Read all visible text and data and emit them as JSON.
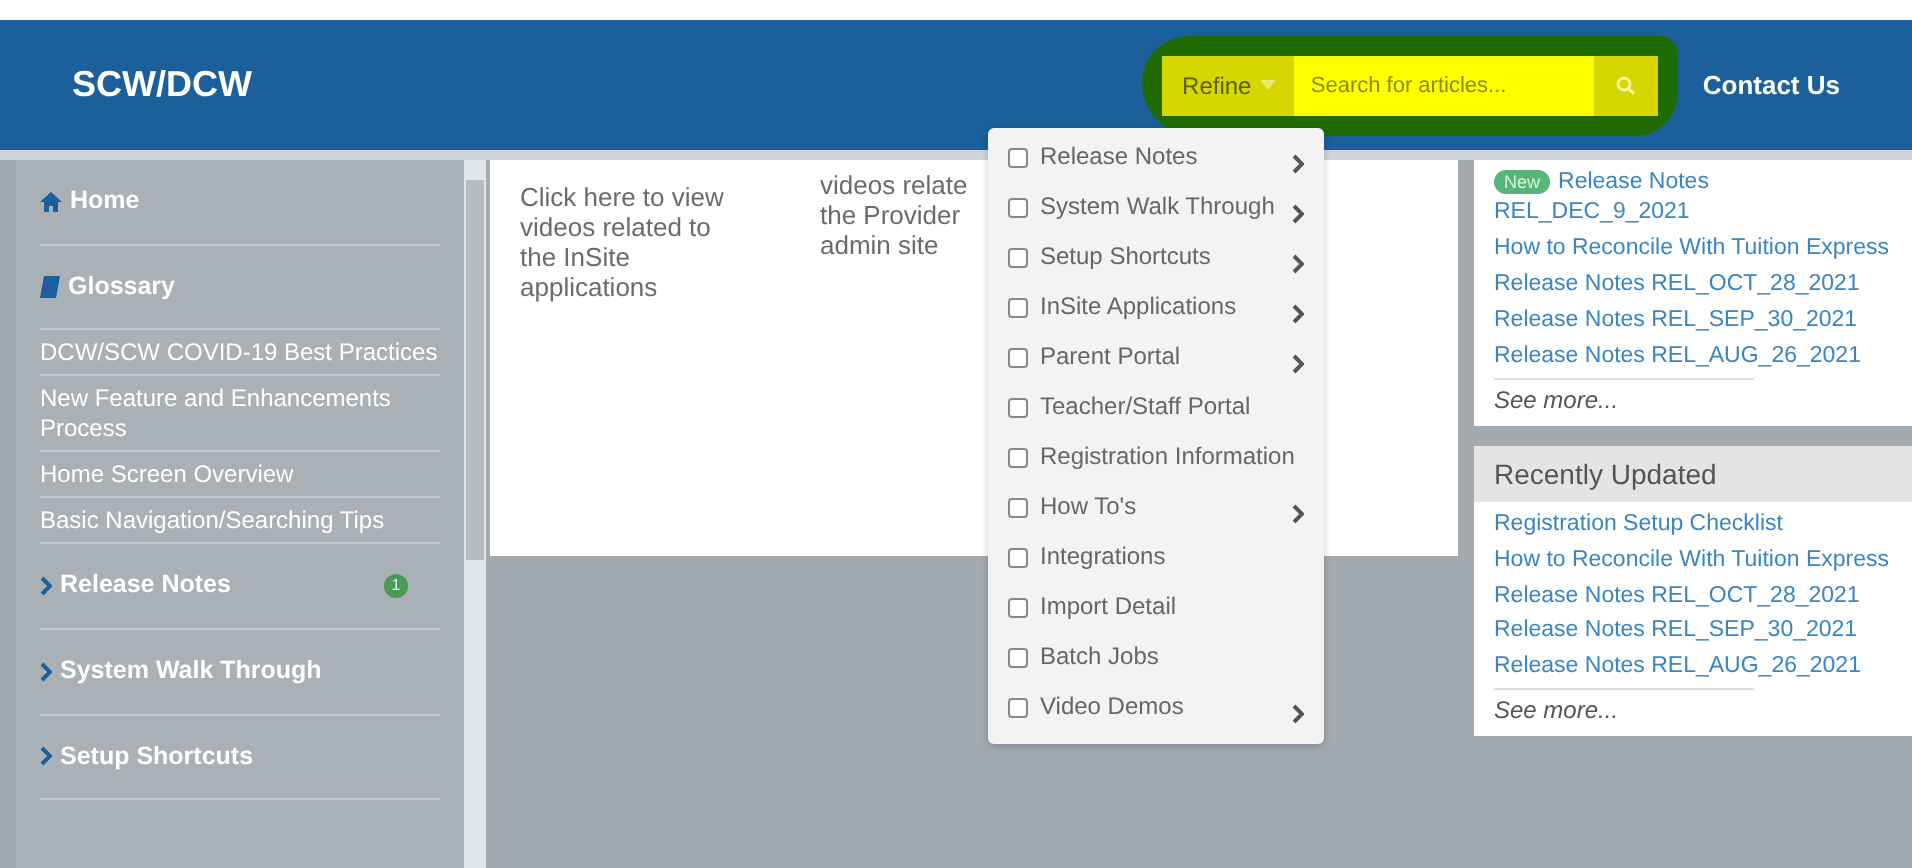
{
  "header": {
    "title": "SCW/DCW",
    "refine": "Refine",
    "search": {
      "placeholder": "Search for articles..."
    },
    "contact": "Contact Us"
  },
  "sidebar": {
    "items": [
      {
        "kind": "home",
        "label": "Home"
      },
      {
        "kind": "book",
        "label": "Glossary"
      },
      {
        "kind": "link",
        "label": "DCW/SCW COVID-19 Best Practices"
      },
      {
        "kind": "link",
        "label": "New Feature and Enhancements Process"
      },
      {
        "kind": "link",
        "label": "Home Screen Overview"
      },
      {
        "kind": "link",
        "label": "Basic Navigation/Searching Tips"
      },
      {
        "kind": "section",
        "label": "Release Notes",
        "badge": "1"
      },
      {
        "kind": "section",
        "label": "System Walk Through"
      },
      {
        "kind": "section",
        "label": "Setup Shortcuts"
      }
    ]
  },
  "tiles": [
    {
      "lines": [
        "Click here to view",
        "videos related to",
        "the InSite",
        "applications"
      ]
    },
    {
      "lines": [
        "videos relate",
        "the Provider",
        "admin site"
      ]
    }
  ],
  "refine_menu": {
    "items": [
      {
        "label": "Release Notes",
        "checked": false,
        "submenu": true
      },
      {
        "label": "System Walk Through",
        "checked": false,
        "submenu": true
      },
      {
        "label": "Setup Shortcuts",
        "checked": false,
        "submenu": true
      },
      {
        "label": "InSite Applications",
        "checked": false,
        "submenu": true
      },
      {
        "label": "Parent Portal",
        "checked": false,
        "submenu": true
      },
      {
        "label": "Teacher/Staff Portal",
        "checked": false,
        "submenu": false
      },
      {
        "label": "Registration Information",
        "checked": false,
        "submenu": false
      },
      {
        "label": "How To's",
        "checked": false,
        "submenu": true
      },
      {
        "label": "Integrations",
        "checked": false,
        "submenu": false
      },
      {
        "label": "Import Detail",
        "checked": false,
        "submenu": false
      },
      {
        "label": "Batch Jobs",
        "checked": false,
        "submenu": false
      },
      {
        "label": "Video Demos",
        "checked": false,
        "submenu": true
      }
    ]
  },
  "latest": {
    "items": [
      {
        "badge": "New",
        "label": "Release Notes REL_DEC_9_2021"
      },
      {
        "label": "How to Reconcile With Tuition Express"
      },
      {
        "label": "Release Notes REL_OCT_28_2021"
      },
      {
        "label": "Release Notes REL_SEP_30_2021"
      },
      {
        "label": "Release Notes REL_AUG_26_2021"
      }
    ],
    "see_more": "See more..."
  },
  "recently_updated": {
    "title": "Recently Updated",
    "items": [
      {
        "label": "Registration Setup Checklist"
      },
      {
        "label": "How to Reconcile With Tuition Express"
      },
      {
        "label": "Release Notes REL_OCT_28_2021"
      },
      {
        "label": "Release Notes REL_SEP_30_2021"
      },
      {
        "label": "Release Notes REL_AUG_26_2021"
      }
    ],
    "see_more": "See more..."
  }
}
